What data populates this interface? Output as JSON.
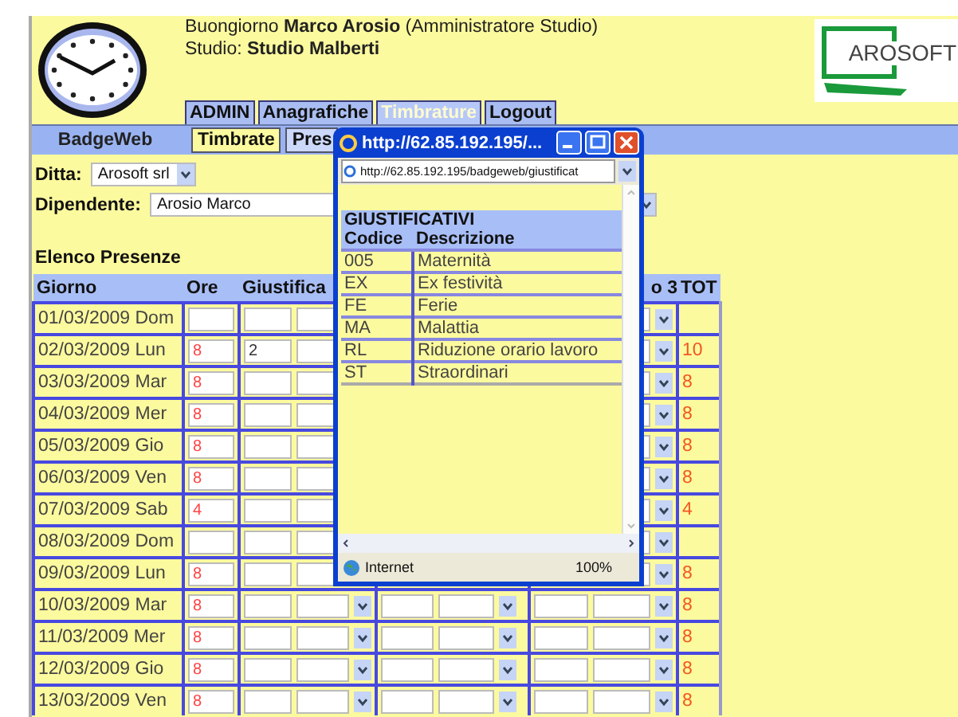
{
  "header": {
    "greeting": "Buongiorno **Marco Arosio** (Amministratore Studio)",
    "studio": "Studio: **Studio Malberti**",
    "logo": "AROSOFT"
  },
  "menu": [
    {
      "label": "ADMIN",
      "selected": false
    },
    {
      "label": "Anagrafiche",
      "selected": false
    },
    {
      "label": "Timbrature",
      "selected": true
    },
    {
      "label": "Logout",
      "selected": false
    }
  ],
  "nav": {
    "brand": "BadgeWeb",
    "tabs": [
      {
        "label": "Timbrate",
        "selected": true
      },
      {
        "label": "Pres",
        "selected": false
      }
    ]
  },
  "filters": {
    "ditta": {
      "label": "Ditta:",
      "value": "Arosoft srl"
    },
    "dipendente": {
      "label": "Dipendente:",
      "value": "Arosio Marco"
    }
  },
  "section_title": "Elenco Presenze",
  "table": {
    "columns": {
      "giorno": "Giorno",
      "ore": "Ore",
      "giustifica": "Giustifica",
      "column_4": "o 3",
      "tot": "TOT"
    },
    "rows": [
      {
        "giorno": "01/03/2009 Dom"
      },
      {
        "giorno": "02/03/2009 Lun",
        "ore": "8",
        "giustifica": "2",
        "tot": "10"
      },
      {
        "giorno": "03/03/2009 Mar",
        "ore": "8",
        "tot": "8"
      },
      {
        "giorno": "04/03/2009 Mer",
        "ore": "8",
        "tot": "8"
      },
      {
        "giorno": "05/03/2009 Gio",
        "ore": "8",
        "tot": "8"
      },
      {
        "giorno": "06/03/2009 Ven",
        "ore": "8",
        "tot": "8"
      },
      {
        "giorno": "07/03/2009 Sab",
        "ore": "4",
        "tot": "4"
      },
      {
        "giorno": "08/03/2009 Dom"
      },
      {
        "giorno": "09/03/2009 Lun",
        "ore": "8",
        "tot": "8"
      },
      {
        "giorno": "10/03/2009 Mar",
        "ore": "8",
        "tot": "8"
      },
      {
        "giorno": "11/03/2009 Mer",
        "ore": "8",
        "tot": "8"
      },
      {
        "giorno": "12/03/2009 Gio",
        "ore": "8",
        "tot": "8"
      },
      {
        "giorno": "13/03/2009 Ven",
        "ore": "8",
        "tot": "8"
      }
    ]
  },
  "popup": {
    "title": "http://62.85.192.195/...",
    "address": "http://62.85.192.195/badgeweb/giustificat",
    "table": {
      "title": "GIUSTIFICATIVI",
      "columns": [
        "Codice",
        "Descrizione"
      ],
      "rows": [
        [
          "005",
          "Maternità"
        ],
        [
          "EX",
          "Ex festività"
        ],
        [
          "FE",
          "Ferie"
        ],
        [
          "MA",
          "Malattia"
        ],
        [
          "RL",
          "Riduzione orario lavoro"
        ],
        [
          "ST",
          "Straordinari"
        ]
      ]
    },
    "status": "Internet",
    "zoom": "100%"
  }
}
